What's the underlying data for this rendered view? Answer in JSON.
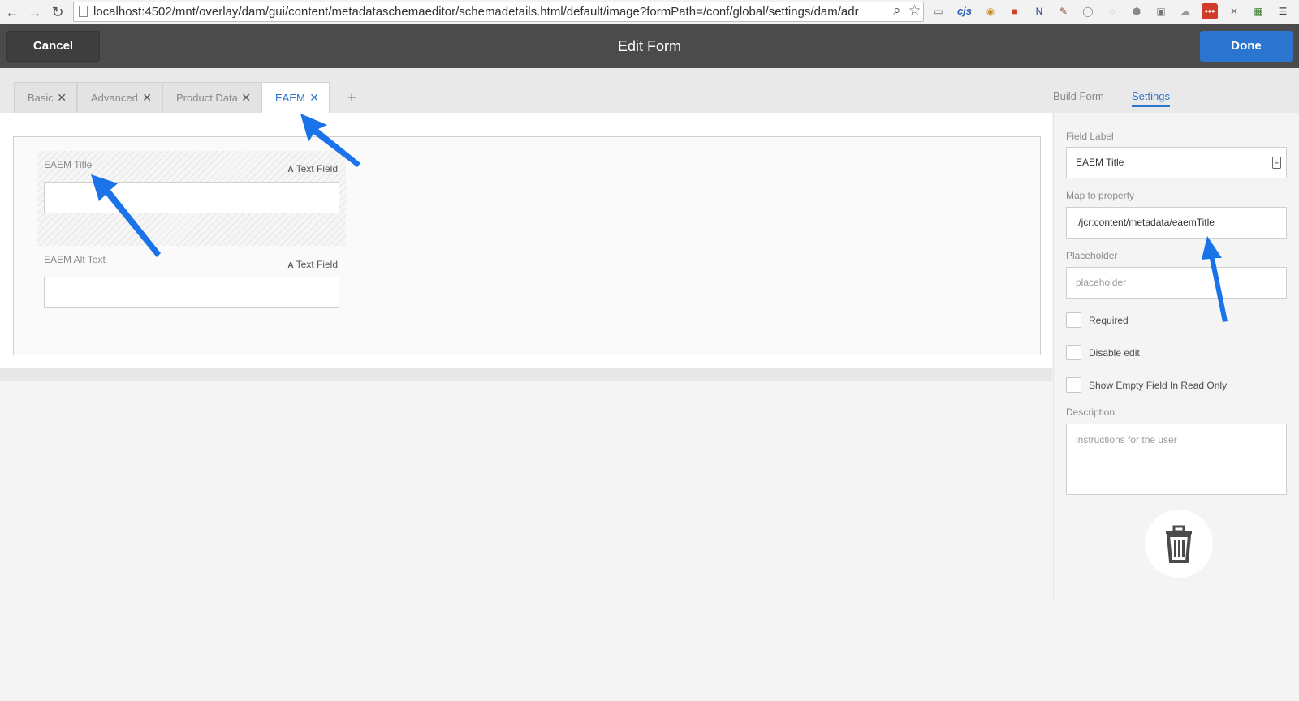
{
  "browser": {
    "url": "localhost:4502/mnt/overlay/dam/gui/content/metadataschemaeditor/schemadetails.html/default/image?formPath=/conf/global/settings/dam/adr",
    "extensions": [
      {
        "name": "cast-icon",
        "glyph": "▭",
        "color": "#666"
      },
      {
        "name": "cjs-icon",
        "glyph": "cjs",
        "color": "#2f5fb5"
      },
      {
        "name": "extension-icon-1",
        "glyph": "◉",
        "color": "#c7902c"
      },
      {
        "name": "extension-icon-2",
        "glyph": "■",
        "color": "#d23b2b"
      },
      {
        "name": "extension-icon-3",
        "glyph": "N",
        "color": "#1d3b8a"
      },
      {
        "name": "pen-icon",
        "glyph": "✎",
        "color": "#8a4a2a"
      },
      {
        "name": "extension-icon-4",
        "glyph": "◯",
        "color": "#888"
      },
      {
        "name": "extension-icon-5",
        "glyph": "◌",
        "color": "#aaa"
      },
      {
        "name": "extension-icon-6",
        "glyph": "⬢",
        "color": "#888"
      },
      {
        "name": "extension-icon-7",
        "glyph": "▣",
        "color": "#777"
      },
      {
        "name": "cloud-icon",
        "glyph": "☁",
        "color": "#999"
      },
      {
        "name": "extension-icon-8",
        "glyph": "•••",
        "color": "#fff"
      },
      {
        "name": "extension-icon-9",
        "glyph": "✕",
        "color": "#777"
      },
      {
        "name": "extension-icon-10",
        "glyph": "▦",
        "color": "#3a7a2a"
      },
      {
        "name": "menu-icon",
        "glyph": "☰",
        "color": "#444"
      }
    ]
  },
  "header": {
    "cancel_label": "Cancel",
    "title": "Edit Form",
    "done_label": "Done"
  },
  "tabs": [
    {
      "label": "Basic",
      "close": "✕"
    },
    {
      "label": "Advanced",
      "close": "✕"
    },
    {
      "label": "Product Data",
      "close": "✕"
    },
    {
      "label": "EAEM",
      "close": "✕"
    }
  ],
  "add_tab": "+",
  "right_tabs": {
    "build_form": "Build Form",
    "settings": "Settings"
  },
  "form_fields": [
    {
      "label": "EAEM Title",
      "type_glyph": "A",
      "type": "Text Field"
    },
    {
      "label": "EAEM Alt Text",
      "type_glyph": "A",
      "type": "Text Field"
    }
  ],
  "settings": {
    "field_label_title": "Field Label",
    "field_label_value": "EAEM Title",
    "map_property_title": "Map to property",
    "map_property_value": "./jcr:content/metadata/eaemTitle",
    "placeholder_title": "Placeholder",
    "placeholder_value": "placeholder",
    "required_label": "Required",
    "disable_edit_label": "Disable edit",
    "show_empty_label": "Show Empty Field In Read Only",
    "description_title": "Description",
    "description_placeholder": "instructions for the user"
  },
  "colors": {
    "accent": "#2b74d0",
    "header_bg": "#4b4b4b",
    "annotation_arrow": "#1a73e8"
  }
}
